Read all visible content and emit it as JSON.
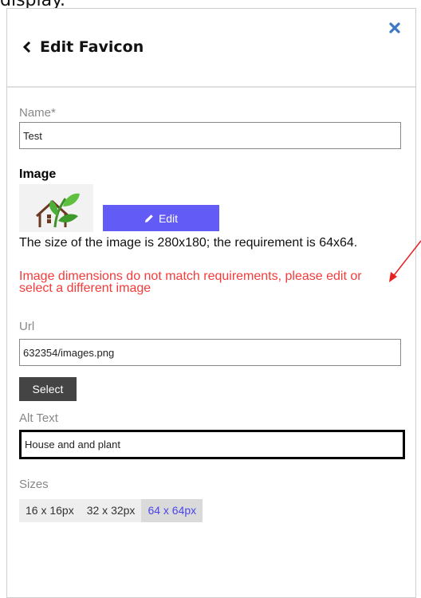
{
  "page": {
    "top_text": "display."
  },
  "header": {
    "title": "Edit Favicon"
  },
  "form": {
    "name": {
      "label": "Name*",
      "value": "Test"
    },
    "image": {
      "heading": "Image",
      "edit_label": "Edit",
      "info": "The size of the image is 280x180; the requirement is 64x64.",
      "error": "Image dimensions do not match requirements, please edit or select a different image"
    },
    "url": {
      "label": "Url",
      "value": "632354/images.png",
      "select_label": "Select"
    },
    "alt": {
      "label": "Alt Text",
      "value": "House and and plant"
    },
    "sizes": {
      "label": "Sizes",
      "options": [
        "16 x 16px",
        "32 x 32px",
        "64 x 64px"
      ],
      "selected": "64 x 64px"
    }
  },
  "colors": {
    "accent": "#635bf5",
    "error": "#f33b3b",
    "selected_size_text": "#4b45e8",
    "select_button": "#444444"
  }
}
